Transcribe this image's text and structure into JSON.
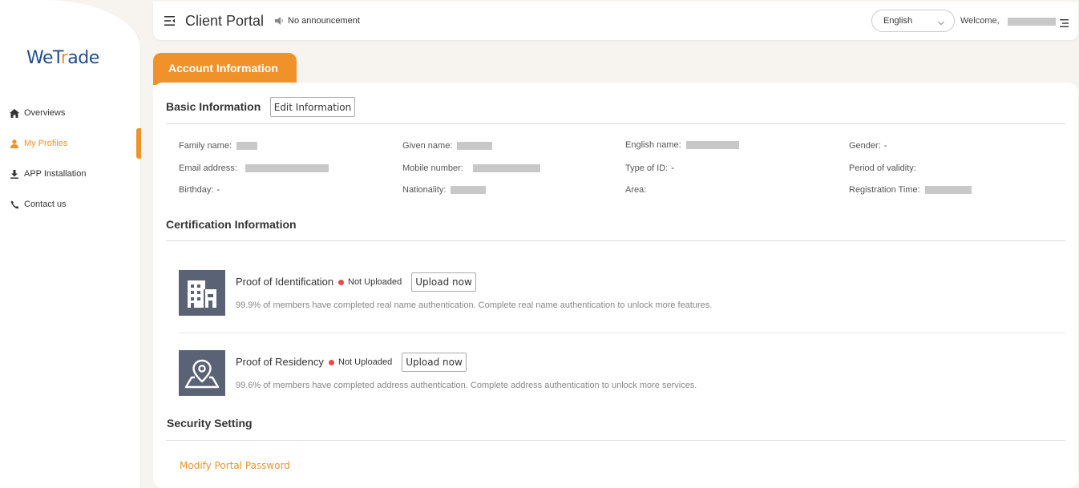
{
  "brand": {
    "logo_prefix": "WeT",
    "logo_accent": "r",
    "logo_suffix": "ade",
    "brand_color": "#1f4e8c",
    "accent_color": "#f0922a"
  },
  "sidebar": {
    "items": [
      {
        "label": "Overviews",
        "icon": "home-icon",
        "active": false
      },
      {
        "label": "My Profiles",
        "icon": "user-icon",
        "active": true
      },
      {
        "label": "APP Installation",
        "icon": "download-icon",
        "active": false
      },
      {
        "label": "Contact us",
        "icon": "phone-icon",
        "active": false
      }
    ]
  },
  "header": {
    "title": "Client Portal",
    "announcement": "No announcement",
    "language": "English",
    "welcome": "Welcome,"
  },
  "tab": {
    "label": "Account Information"
  },
  "basic": {
    "title": "Basic Information",
    "edit_label": "Edit Information",
    "fields": {
      "family_name": {
        "label": "Family name:",
        "value": ""
      },
      "given_name": {
        "label": "Given name:",
        "value": ""
      },
      "english_name": {
        "label": "English name:",
        "value": ""
      },
      "gender": {
        "label": "Gender:",
        "value": "-"
      },
      "email": {
        "label": "Email address:",
        "value": ""
      },
      "mobile": {
        "label": "Mobile number:",
        "value": ""
      },
      "type_of_id": {
        "label": "Type of ID:",
        "value": "-"
      },
      "period": {
        "label": "Period of validity:",
        "value": ""
      },
      "birthday": {
        "label": "Birthday:",
        "value": "-"
      },
      "nationality": {
        "label": "Nationality:",
        "value": ""
      },
      "area": {
        "label": "Area:",
        "value": ""
      },
      "registration": {
        "label": "Registration Time:",
        "value": ""
      }
    }
  },
  "certification": {
    "title": "Certification Information",
    "items": [
      {
        "title": "Proof of Identification",
        "status": "Not Uploaded",
        "button": "Upload now",
        "description": "99.9% of members have completed real name authentication. Complete real name authentication to unlock more features.",
        "icon": "building-icon"
      },
      {
        "title": "Proof of Residency",
        "status": "Not Uploaded",
        "button": "Upload now",
        "description": "99.6% of members have completed address authentication. Complete address authentication to unlock more services.",
        "icon": "map-pin-icon"
      }
    ]
  },
  "security": {
    "title": "Security Setting",
    "modify_password": "Modify Portal Password"
  }
}
